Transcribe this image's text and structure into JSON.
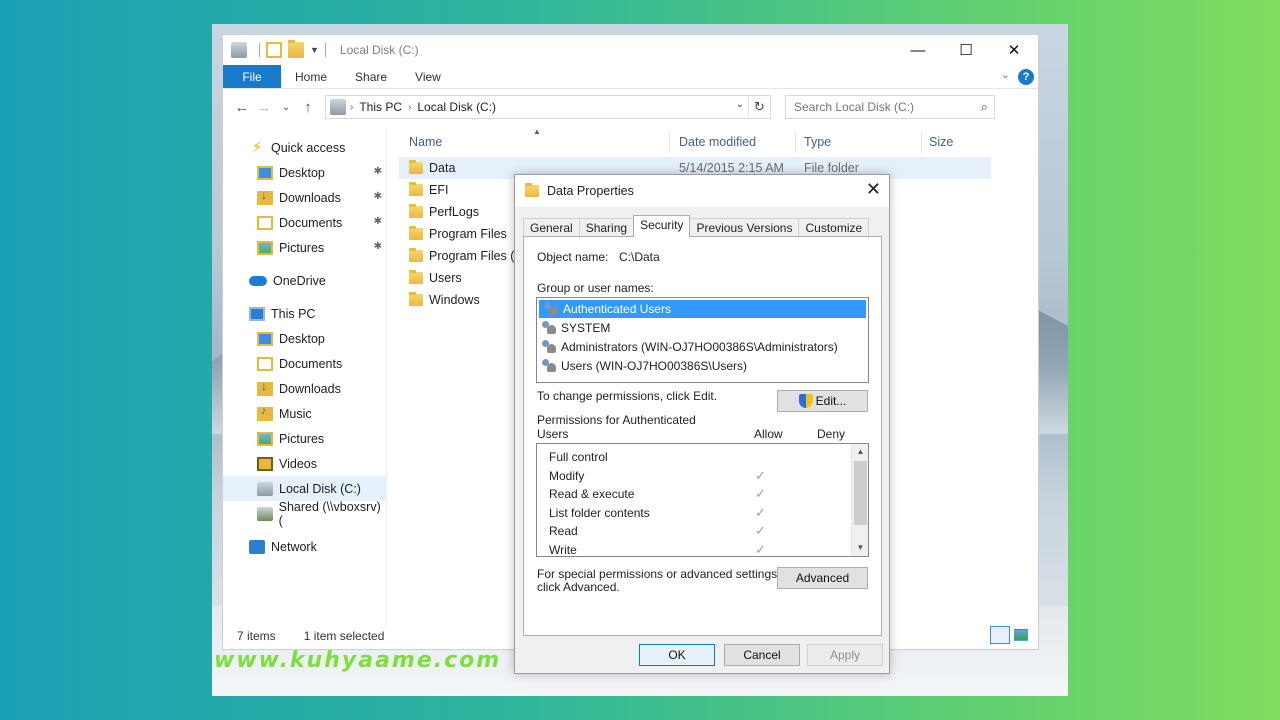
{
  "explorer": {
    "title": "Local Disk (C:)",
    "controls": {
      "minimize": "—",
      "maximize": "☐",
      "close": "✕"
    },
    "ribbon": {
      "file": "File",
      "tabs": [
        "Home",
        "Share",
        "View"
      ],
      "help": "?",
      "collapse": "⌄"
    },
    "nav": {
      "back": "←",
      "forward": "→",
      "recent": "⌄",
      "up": "↑"
    },
    "address": {
      "crumbs": [
        "This PC",
        "Local Disk (C:)"
      ],
      "dropdown": "⌄",
      "refresh": "↻"
    },
    "search": {
      "placeholder": "Search Local Disk (C:)",
      "icon": "⌕"
    },
    "navpane": {
      "quick_access": "Quick access",
      "quick_items": [
        "Desktop",
        "Downloads",
        "Documents",
        "Pictures"
      ],
      "pin": "📌",
      "onedrive": "OneDrive",
      "this_pc": "This PC",
      "pc_items": [
        "Desktop",
        "Documents",
        "Downloads",
        "Music",
        "Pictures",
        "Videos",
        "Local Disk (C:)",
        "Shared (\\\\vboxsrv) ("
      ],
      "network": "Network"
    },
    "columns": {
      "name": "Name",
      "date": "Date modified",
      "type": "Type",
      "size": "Size",
      "sort": "▲"
    },
    "files": [
      {
        "name": "Data",
        "date": "5/14/2015 2:15 AM",
        "type": "File folder"
      },
      {
        "name": "EFI"
      },
      {
        "name": "PerfLogs"
      },
      {
        "name": "Program Files"
      },
      {
        "name": "Program Files (x"
      },
      {
        "name": "Users"
      },
      {
        "name": "Windows"
      }
    ],
    "status": {
      "items": "7 items",
      "selected": "1 item selected"
    }
  },
  "dialog": {
    "title": "Data Properties",
    "close": "✕",
    "tabs": [
      "General",
      "Sharing",
      "Security",
      "Previous Versions",
      "Customize"
    ],
    "object_label": "Object name:",
    "object_value": "C:\\Data",
    "groups_label": "Group or user names:",
    "groups": [
      "Authenticated Users",
      "SYSTEM",
      "Administrators (WIN-OJ7HO00386S\\Administrators)",
      "Users (WIN-OJ7HO00386S\\Users)"
    ],
    "change_text": "To change permissions, click Edit.",
    "edit_button": "Edit...",
    "perm_label_line1": "Permissions for Authenticated",
    "perm_label_line2": "Users",
    "allow": "Allow",
    "deny": "Deny",
    "permissions": [
      {
        "name": "Full control",
        "allow": ""
      },
      {
        "name": "Modify",
        "allow": "✓"
      },
      {
        "name": "Read & execute",
        "allow": "✓"
      },
      {
        "name": "List folder contents",
        "allow": "✓"
      },
      {
        "name": "Read",
        "allow": "✓"
      },
      {
        "name": "Write",
        "allow": "✓"
      }
    ],
    "scroll_up": "▲",
    "scroll_down": "▼",
    "special_line1": "For special permissions or advanced settings,",
    "special_line2": "click Advanced.",
    "advanced_button": "Advanced",
    "ok": "OK",
    "cancel": "Cancel",
    "apply": "Apply"
  },
  "watermark": "www.kuhyaame.com"
}
